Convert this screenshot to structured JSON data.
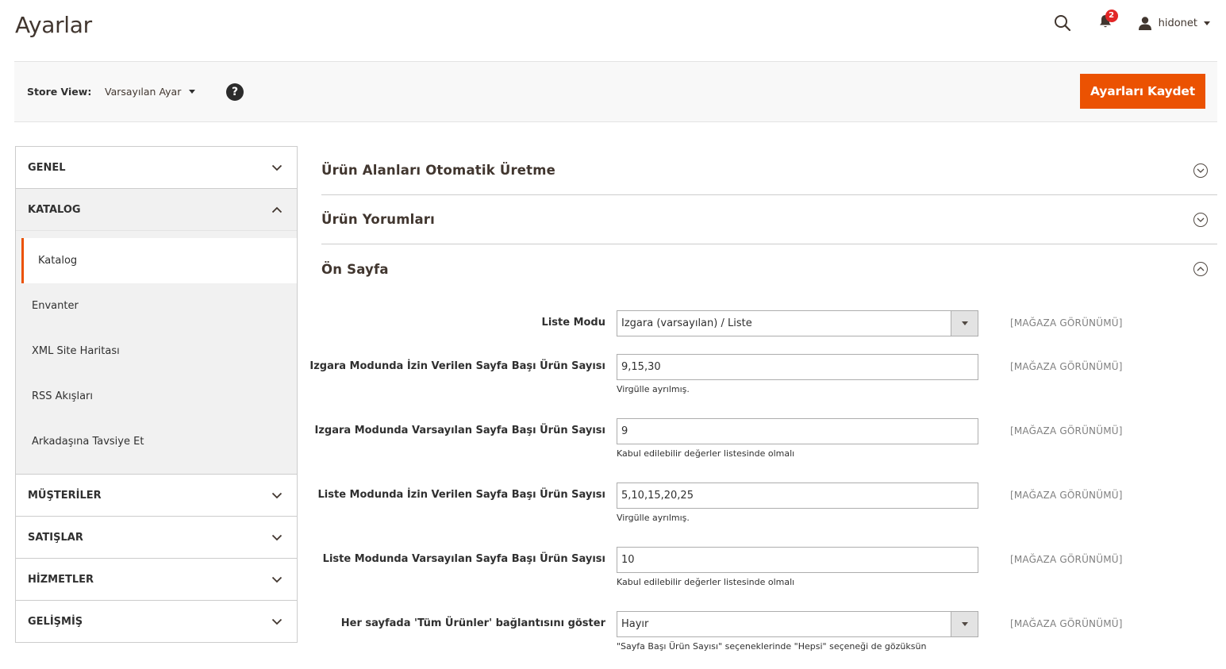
{
  "header": {
    "title": "Ayarlar",
    "notifications_count": "2",
    "username": "hidonet"
  },
  "store_bar": {
    "label": "Store View:",
    "selected": "Varsayılan Ayar",
    "help": "?",
    "save_label": "Ayarları Kaydet"
  },
  "sidebar": {
    "sections": [
      {
        "label": "GENEL"
      },
      {
        "label": "KATALOG"
      },
      {
        "label": "MÜŞTERİLER"
      },
      {
        "label": "SATIŞLAR"
      },
      {
        "label": "HİZMETLER"
      },
      {
        "label": "GELİŞMİŞ"
      }
    ],
    "katalog_items": [
      {
        "label": "Katalog"
      },
      {
        "label": "Envanter"
      },
      {
        "label": "XML Site Haritası"
      },
      {
        "label": "RSS Akışları"
      },
      {
        "label": "Arkadaşına Tavsiye Et"
      }
    ]
  },
  "main": {
    "groups": [
      {
        "title": "Ürün Alanları Otomatik Üretme"
      },
      {
        "title": "Ürün Yorumları"
      },
      {
        "title": "Ön Sayfa"
      }
    ],
    "fields": [
      {
        "label": "Liste Modu",
        "value": "Izgara (varsayılan) / Liste",
        "note": "",
        "scope": "[MAĞAZA GÖRÜNÜMÜ]"
      },
      {
        "label": "Izgara Modunda İzin Verilen Sayfa Başı Ürün Sayısı",
        "value": "9,15,30",
        "note": "Virgülle ayrılmış.",
        "scope": "[MAĞAZA GÖRÜNÜMÜ]"
      },
      {
        "label": "Izgara Modunda Varsayılan Sayfa Başı Ürün Sayısı",
        "value": "9",
        "note": "Kabul edilebilir değerler listesinde olmalı",
        "scope": "[MAĞAZA GÖRÜNÜMÜ]"
      },
      {
        "label": "Liste Modunda İzin Verilen Sayfa Başı Ürün Sayısı",
        "value": "5,10,15,20,25",
        "note": "Virgülle ayrılmış.",
        "scope": "[MAĞAZA GÖRÜNÜMÜ]"
      },
      {
        "label": "Liste Modunda Varsayılan Sayfa Başı Ürün Sayısı",
        "value": "10",
        "note": "Kabul edilebilir değerler listesinde olmalı",
        "scope": "[MAĞAZA GÖRÜNÜMÜ]"
      },
      {
        "label": "Her sayfada 'Tüm Ürünler' bağlantısını göster",
        "value": "Hayır",
        "note": "\"Sayfa Başı Ürün Sayısı\" seçeneklerinde \"Hepsi\" seçeneği de gözüksün",
        "scope": "[MAĞAZA GÖRÜNÜMÜ]"
      }
    ]
  }
}
